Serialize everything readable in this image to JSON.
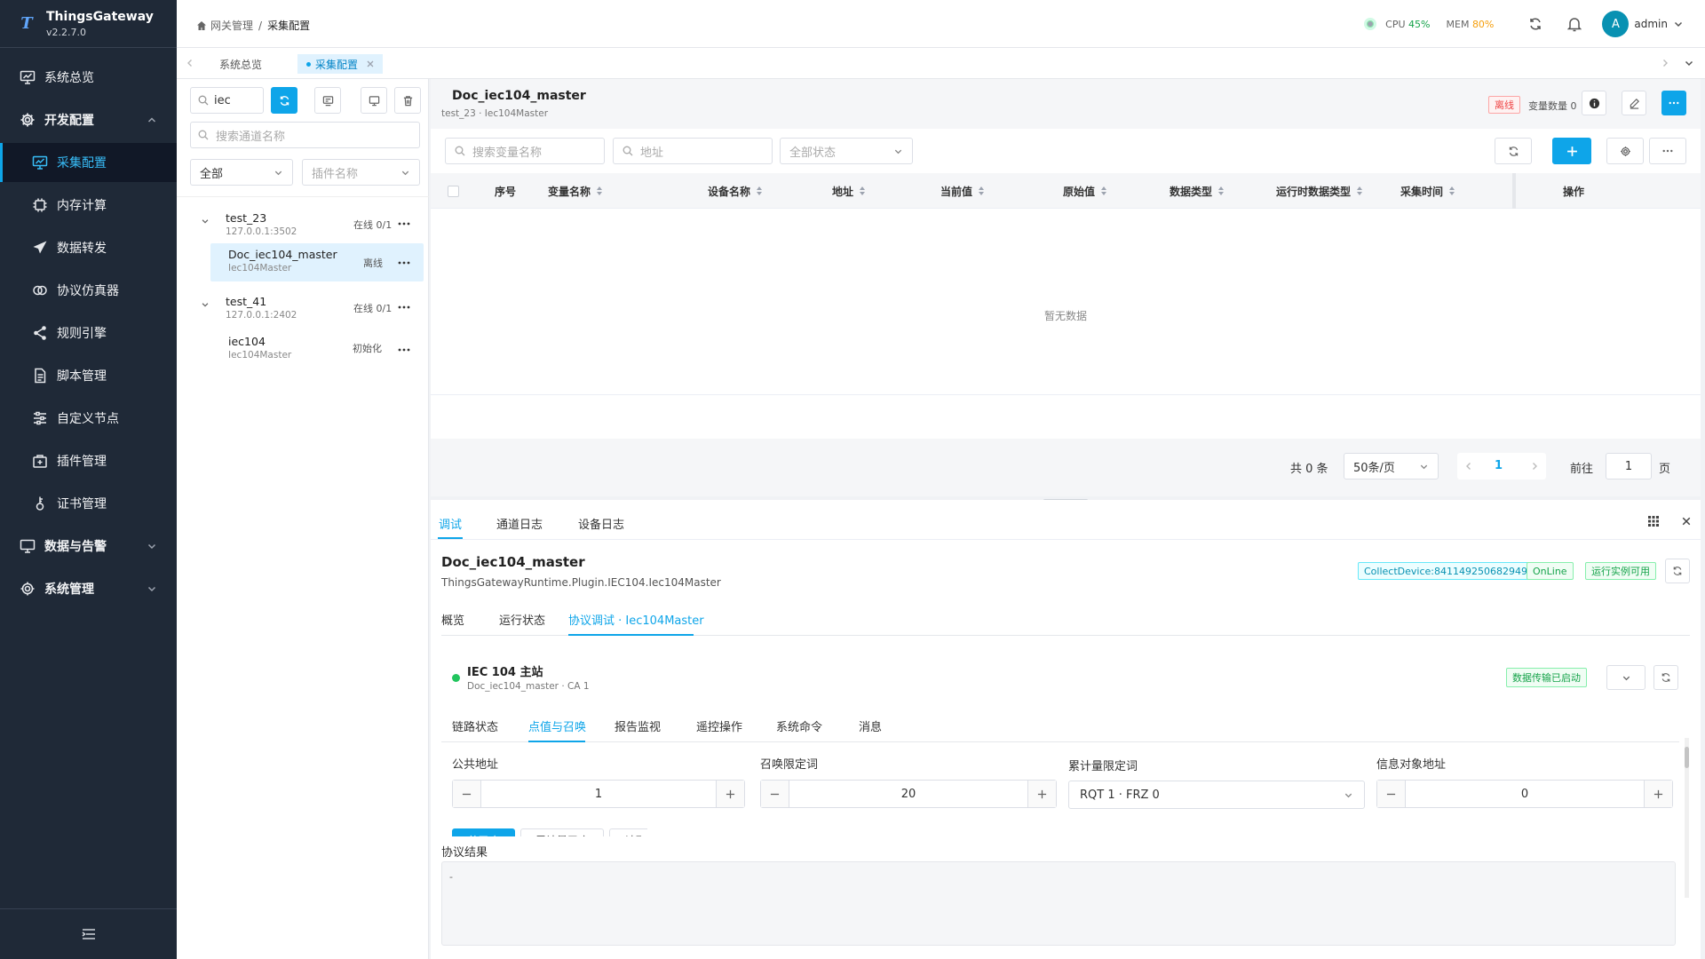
{
  "app": {
    "name": "ThingsGateway",
    "version": "v2.2.7.0",
    "logo_letter": "T"
  },
  "sidebar": {
    "items": [
      {
        "label": "系统总览",
        "icon": "monitor-chart-icon"
      },
      {
        "label": "开发配置",
        "icon": "gear-icon"
      },
      {
        "label": "采集配置",
        "icon": "chart-screen-icon"
      },
      {
        "label": "内存计算",
        "icon": "chip-icon"
      },
      {
        "label": "数据转发",
        "icon": "send-icon"
      },
      {
        "label": "协议仿真器",
        "icon": "link-loop-icon"
      },
      {
        "label": "规则引擎",
        "icon": "share-icon"
      },
      {
        "label": "脚本管理",
        "icon": "document-icon"
      },
      {
        "label": "自定义节点",
        "icon": "sliders-icon"
      },
      {
        "label": "插件管理",
        "icon": "plugin-box-icon"
      },
      {
        "label": "证书管理",
        "icon": "key-icon"
      },
      {
        "label": "数据与告警",
        "icon": "monitor-alert-icon"
      },
      {
        "label": "系统管理",
        "icon": "gear-icon"
      }
    ]
  },
  "header": {
    "breadcrumb": [
      "网关管理",
      "采集配置"
    ],
    "separator": "/",
    "cpu_label": "CPU",
    "cpu_value": "45%",
    "mem_label": "MEM",
    "mem_value": "80%",
    "user_initial": "A",
    "user_name": "admin"
  },
  "page_tabs": {
    "tabs": [
      "系统总览",
      "采集配置"
    ]
  },
  "channel_panel": {
    "search_value": "iec",
    "channel_search_placeholder": "搜索通道名称",
    "filter_all": "全部",
    "plugin_placeholder": "插件名称",
    "tree": [
      {
        "name": "test_23",
        "addr": "127.0.0.1:3502",
        "status": "在线 0/1",
        "children": [
          {
            "name": "Doc_iec104_master",
            "plugin": "Iec104Master",
            "status": "离线"
          }
        ]
      },
      {
        "name": "test_41",
        "addr": "127.0.0.1:2402",
        "status": "在线 0/1",
        "children": [
          {
            "name": "iec104",
            "plugin": "Iec104Master",
            "status": "初始化"
          }
        ]
      }
    ]
  },
  "device": {
    "title": "Doc_iec104_master",
    "subtitle": "test_23 · Iec104Master",
    "status": "离线",
    "var_count_label": "变量数量 0",
    "var_search_placeholder": "搜索变量名称",
    "addr_placeholder": "地址",
    "status_filter": "全部状态",
    "columns": [
      "序号",
      "变量名称",
      "设备名称",
      "地址",
      "当前值",
      "原始值",
      "数据类型",
      "运行时数据类型",
      "采集时间",
      "操作"
    ],
    "empty_text": "暂无数据",
    "total": "共 0 条",
    "page_size": "50条/页",
    "current_page": "1",
    "goto_label": "前往",
    "goto_value": "1",
    "page_unit": "页"
  },
  "debug": {
    "tabs": [
      "调试",
      "通道日志",
      "设备日志"
    ],
    "title": "Doc_iec104_master",
    "plugin_path": "ThingsGatewayRuntime.Plugin.IEC104.Iec104Master",
    "badge_collect": "CollectDevice:841149250682949",
    "badge_online": "OnLine",
    "badge_runtime": "运行实例可用",
    "sub_tabs": [
      "概览",
      "运行状态",
      "协议调试 · Iec104Master"
    ],
    "station_name": "IEC 104 主站",
    "station_sub": "Doc_iec104_master · CA 1",
    "transfer_badge": "数据传输已启动",
    "proto_tabs": [
      "链路状态",
      "点值与召唤",
      "报告监视",
      "遥控操作",
      "系统命令",
      "消息"
    ],
    "fields": {
      "common_addr_label": "公共地址",
      "common_addr": "1",
      "qoi_label": "召唤限定词",
      "qoi": "20",
      "qcc_label": "累计量限定词",
      "qcc": "RQT 1 · FRZ 0",
      "ioa_label": "信息对象地址",
      "ioa": "0"
    },
    "buttons": [
      "总召唤",
      "累计量召唤",
      "读取点值"
    ],
    "result_label": "协议结果",
    "result_text": "-"
  },
  "colors": {
    "accent": "#0ea5e9",
    "sidebar": "#1f2937",
    "online": "#16a34a",
    "offline": "#ef4444"
  }
}
